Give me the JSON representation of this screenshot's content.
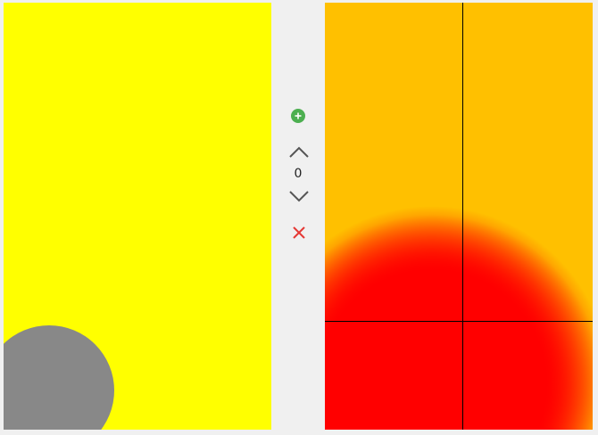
{
  "controls": {
    "counter_value": "0",
    "icons": {
      "add": "plus-circle-icon",
      "increment": "chevron-up-icon",
      "decrement": "chevron-down-icon",
      "remove": "close-icon"
    }
  },
  "colors": {
    "left_canvas": "#ffff00",
    "circle": "#888888",
    "right_canvas": "#ffc000",
    "hotspot": "#ff0000",
    "add_button": "#4caf50",
    "remove_icon": "#e53935"
  }
}
